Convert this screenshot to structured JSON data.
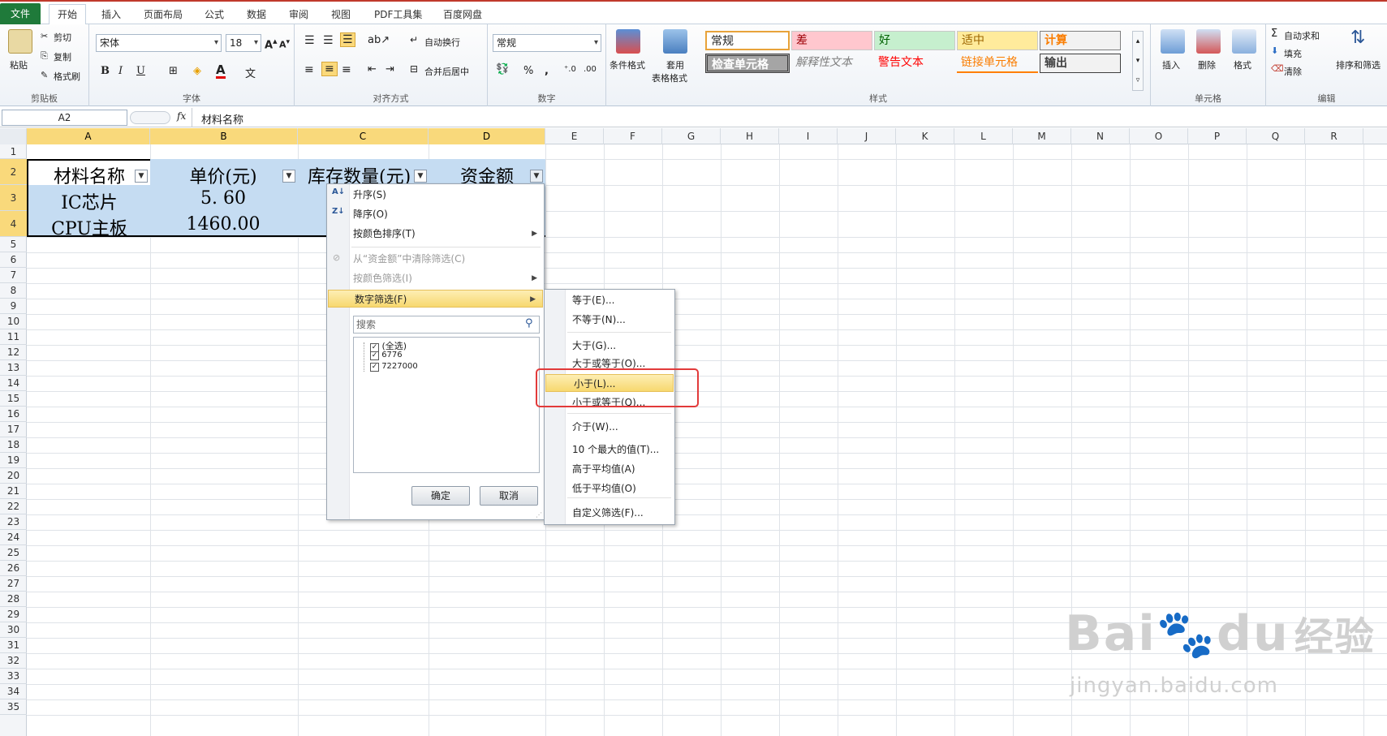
{
  "tabs": [
    "文件",
    "开始",
    "插入",
    "页面布局",
    "公式",
    "数据",
    "审阅",
    "视图",
    "PDF工具集",
    "百度网盘"
  ],
  "clipboard": {
    "paste": "粘贴",
    "cut": "剪切",
    "copy": "复制",
    "format_painter": "格式刷",
    "label": "剪贴板"
  },
  "font": {
    "name": "宋体",
    "size": "18",
    "bold": "B",
    "italic": "I",
    "underline": "U",
    "label": "字体"
  },
  "align": {
    "wrap": "自动换行",
    "merge": "合并后居中",
    "label": "对齐方式"
  },
  "number": {
    "format": "常规",
    "label": "数字",
    "percent": "%",
    "comma": ","
  },
  "styles": {
    "cond_format": "条件格式",
    "table_format_1": "套用",
    "table_format_2": "表格格式",
    "normal": "常规",
    "bad": "差",
    "good": "好",
    "neutral": "适中",
    "calc": "计算",
    "check": "检查单元格",
    "explanatory": "解释性文本",
    "warning": "警告文本",
    "link": "链接单元格",
    "output": "输出",
    "label": "样式"
  },
  "cells": {
    "insert": "插入",
    "delete": "删除",
    "format": "格式",
    "label": "单元格"
  },
  "editing": {
    "autosum": "自动求和",
    "fill": "填充",
    "clear": "清除",
    "sort_filter": "排序和筛选",
    "label": "编辑"
  },
  "formula_bar": {
    "name_box": "A2",
    "fx": "fx",
    "content": "材料名称"
  },
  "columns": [
    "A",
    "B",
    "C",
    "D",
    "E",
    "F",
    "G",
    "H",
    "I",
    "J",
    "K",
    "L",
    "M",
    "N",
    "O",
    "P",
    "Q",
    "R"
  ],
  "rows": [
    "1",
    "2",
    "3",
    "4",
    "5",
    "6",
    "7",
    "8",
    "9",
    "10",
    "11",
    "12",
    "13",
    "14",
    "15",
    "16",
    "17",
    "18",
    "19",
    "20",
    "21",
    "22",
    "23",
    "24",
    "25",
    "26",
    "27",
    "28",
    "29",
    "30",
    "31",
    "32",
    "33",
    "34",
    "35"
  ],
  "table": {
    "headers": [
      "材料名称",
      "单价(元)",
      "库存数量(元)",
      "资金额"
    ],
    "rows": [
      [
        "IC芯片",
        "5. 60"
      ],
      [
        "CPU主板",
        "1460.00"
      ]
    ]
  },
  "filter_menu": {
    "sort_asc": "升序(S)",
    "sort_desc": "降序(O)",
    "sort_color": "按颜色排序(T)",
    "clear_filter": "从“资金额”中清除筛选(C)",
    "filter_color": "按颜色筛选(I)",
    "number_filter": "数字筛选(F)",
    "search_placeholder": "搜索",
    "select_all": "(全选)",
    "value1": "6776",
    "value2": "7227000",
    "ok": "确定",
    "cancel": "取消"
  },
  "submenu": [
    "等于(E)...",
    "不等于(N)...",
    "大于(G)...",
    "大于或等于(O)...",
    "小于(L)...",
    "小于或等于(Q)...",
    "介于(W)...",
    "10 个最大的值(T)...",
    "高于平均值(A)",
    "低于平均值(O)",
    "自定义筛选(F)..."
  ],
  "watermark": {
    "brand": "Bai",
    "brand2": "du",
    "cn": "经验",
    "url": "jingyan.baidu.com"
  }
}
